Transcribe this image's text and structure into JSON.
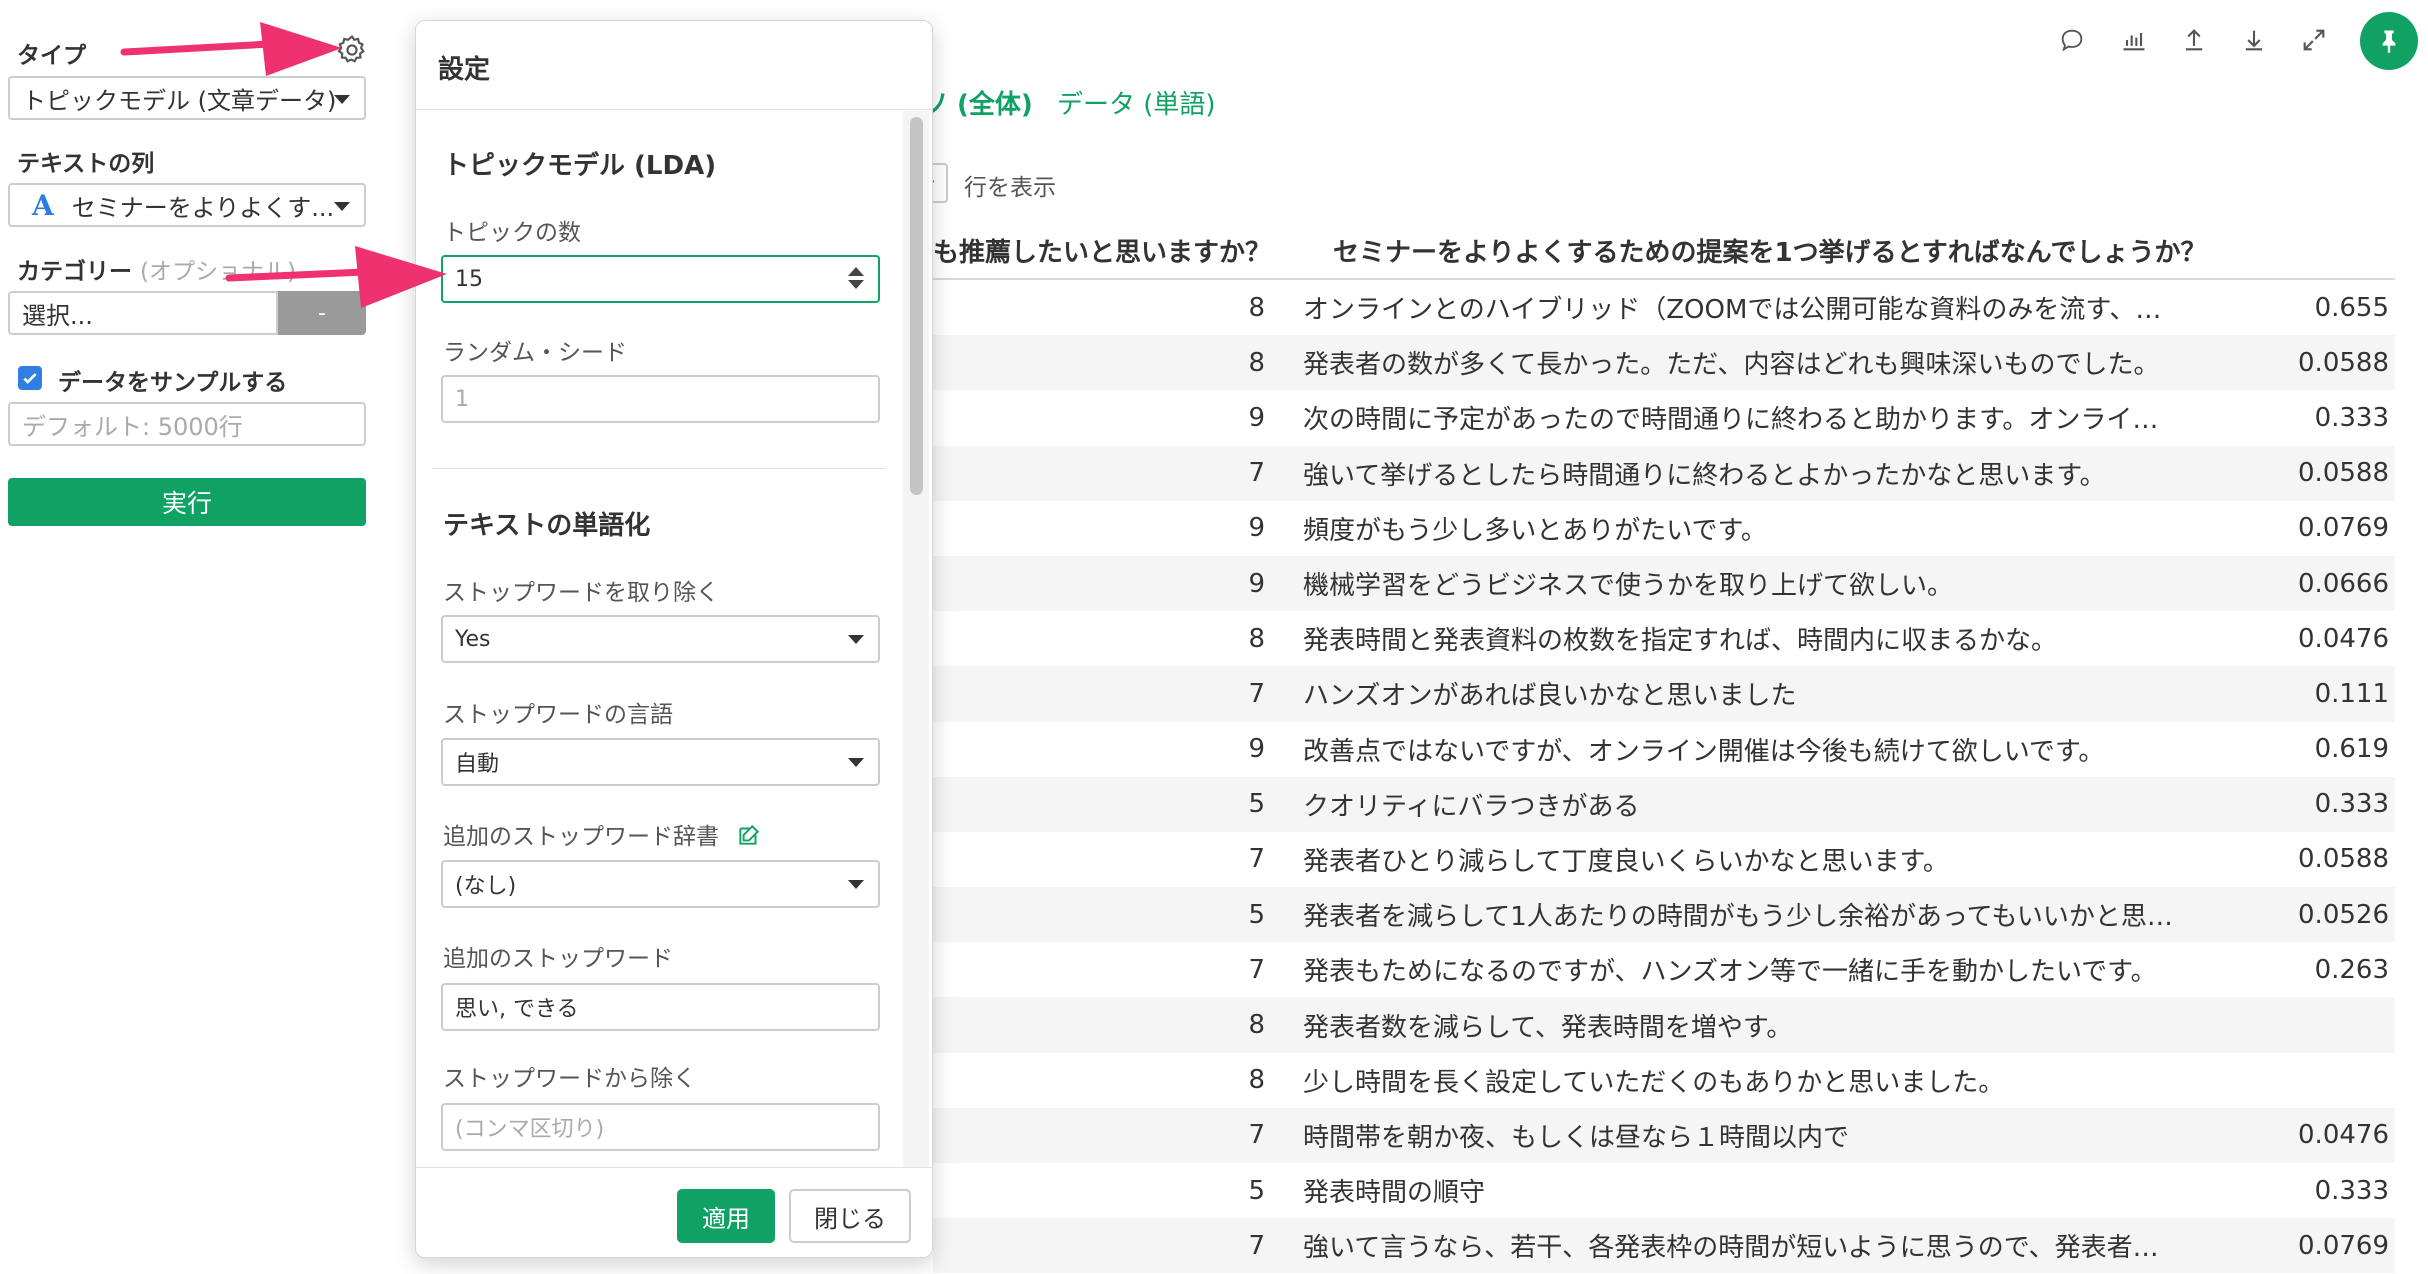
{
  "sidebar": {
    "type_label": "タイプ",
    "type_value": "トピックモデル (文章データ)",
    "text_col_label": "テキストの列",
    "text_col_value": "セミナーをよりよくす...",
    "category_label": "カテゴリー",
    "category_optional": "(オプショナル)",
    "category_placeholder": "選択...",
    "category_button": "-",
    "sample_label": "データをサンプルする",
    "sample_checked": true,
    "sample_placeholder": "デフォルト: 5000行",
    "run_label": "実行"
  },
  "dialog": {
    "title": "設定",
    "section_lda": "トピックモデル (LDA)",
    "num_topics_label": "トピックの数",
    "num_topics_value": "15",
    "seed_label": "ランダム・シード",
    "seed_placeholder": "1",
    "section_tokenize": "テキストの単語化",
    "remove_stopwords_label": "ストップワードを取り除く",
    "remove_stopwords_value": "Yes",
    "stopword_lang_label": "ストップワードの言語",
    "stopword_lang_value": "自動",
    "extra_dict_label": "追加のストップワード辞書",
    "extra_dict_value": "(なし)",
    "extra_stopwords_label": "追加のストップワード",
    "extra_stopwords_value": "思い, できる",
    "exclude_label": "ストップワードから除く",
    "exclude_placeholder": "(コンマ区切り)",
    "apply_label": "適用",
    "close_label": "閉じる"
  },
  "content": {
    "tab_active_fragment": "ソ (全体)",
    "tab_data": "データ (単語)",
    "rows_label": "行を表示",
    "col_rate_header": "も推薦したいと思いますか？",
    "col_text_header": "セミナーをよりよくするための提案を1つ挙げるとすればなんでしょうか？",
    "rows": [
      {
        "rate": "8",
        "text": "オンラインとのハイブリッド（ZOOMでは公開可能な資料のみを流す、…",
        "score": "0.655"
      },
      {
        "rate": "8",
        "text": "発表者の数が多くて長かった。ただ、内容はどれも興味深いものでした。",
        "score": "0.0588"
      },
      {
        "rate": "9",
        "text": "次の時間に予定があったので時間通りに終わると助かります。オンライ…",
        "score": "0.333"
      },
      {
        "rate": "7",
        "text": "強いて挙げるとしたら時間通りに終わるとよかったかなと思います。",
        "score": "0.0588"
      },
      {
        "rate": "9",
        "text": "頻度がもう少し多いとありがたいです。",
        "score": "0.0769"
      },
      {
        "rate": "9",
        "text": "機械学習をどうビジネスで使うかを取り上げて欲しい。",
        "score": "0.0666"
      },
      {
        "rate": "8",
        "text": "発表時間と発表資料の枚数を指定すれば、時間内に収まるかな。",
        "score": "0.0476"
      },
      {
        "rate": "7",
        "text": "ハンズオンがあれば良いかなと思いました",
        "score": "0.111"
      },
      {
        "rate": "9",
        "text": "改善点ではないですが、オンライン開催は今後も続けて欲しいです。",
        "score": "0.619"
      },
      {
        "rate": "5",
        "text": "クオリティにバラつきがある",
        "score": "0.333"
      },
      {
        "rate": "7",
        "text": "発表者ひとり減らして丁度良いくらいかなと思います。",
        "score": "0.0588"
      },
      {
        "rate": "5",
        "text": "発表者を減らして1人あたりの時間がもう少し余裕があってもいいかと思…",
        "score": "0.0526"
      },
      {
        "rate": "7",
        "text": "発表もためになるのですが、ハンズオン等で一緒に手を動かしたいです。",
        "score": "0.263"
      },
      {
        "rate": "8",
        "text": "発表者数を減らして、発表時間を増やす。",
        "score": ""
      },
      {
        "rate": "8",
        "text": "少し時間を長く設定していただくのもありかと思いました。",
        "score": ""
      },
      {
        "rate": "7",
        "text": "時間帯を朝か夜、もしくは昼なら１時間以内で",
        "score": "0.0476"
      },
      {
        "rate": "5",
        "text": "発表時間の順守",
        "score": "0.333"
      },
      {
        "rate": "7",
        "text": "強いて言うなら、若干、各発表枠の時間が短いように思うので、発表者…",
        "score": "0.0769"
      }
    ]
  },
  "colors": {
    "accent": "#10a265",
    "arrow": "#f0316f",
    "link": "#2a7de1"
  }
}
